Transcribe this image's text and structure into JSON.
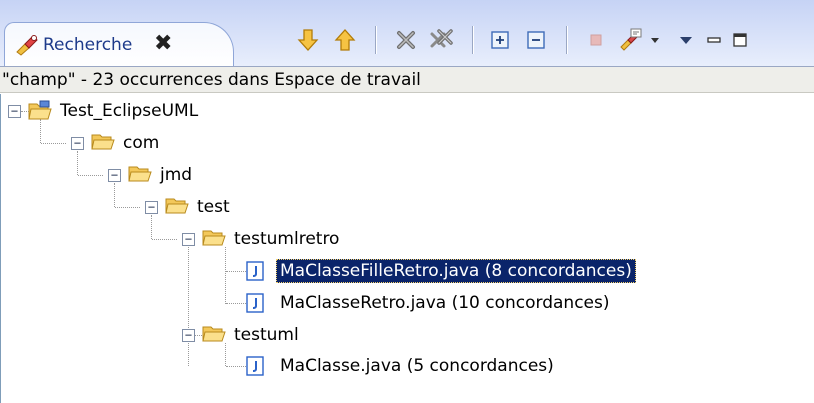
{
  "view": {
    "tab_title": "Recherche",
    "close_glyph": "✖"
  },
  "toolbar": {
    "buttons": [
      {
        "name": "next-match-button",
        "icon": "arrow-down-icon"
      },
      {
        "name": "previous-match-button",
        "icon": "arrow-up-icon"
      },
      {
        "name": "remove-selected-matches-button",
        "icon": "remove-icon"
      },
      {
        "name": "remove-all-matches-button",
        "icon": "remove-all-icon"
      },
      {
        "name": "expand-all-button",
        "icon": "expand-all-icon"
      },
      {
        "name": "collapse-all-button",
        "icon": "collapse-all-icon"
      },
      {
        "name": "cancel-search-button",
        "icon": "stop-icon"
      },
      {
        "name": "previous-searches-button",
        "icon": "search-history-icon"
      },
      {
        "name": "view-menu-button",
        "icon": "chevron-down-icon"
      },
      {
        "name": "minimize-button",
        "icon": "minimize-icon"
      },
      {
        "name": "maximize-button",
        "icon": "maximize-icon"
      }
    ]
  },
  "status": {
    "text": "\"champ\" - 23 occurrences dans Espace de travail"
  },
  "tree": {
    "project": "Test_EclipseUML",
    "pkg_com": "com",
    "pkg_jmd": "jmd",
    "pkg_test": "test",
    "pkg_testumlretro": "testumlretro",
    "file_fille": "MaClasseFilleRetro.java (8 concordances)",
    "file_retro": "MaClasseRetro.java (10 concordances)",
    "pkg_testuml": "testuml",
    "file_maclasse": "MaClasse.java (5 concordances)"
  },
  "colors": {
    "selection": "#0a246a",
    "folder": "#f3c85a",
    "java_file": "#2a62c9"
  }
}
